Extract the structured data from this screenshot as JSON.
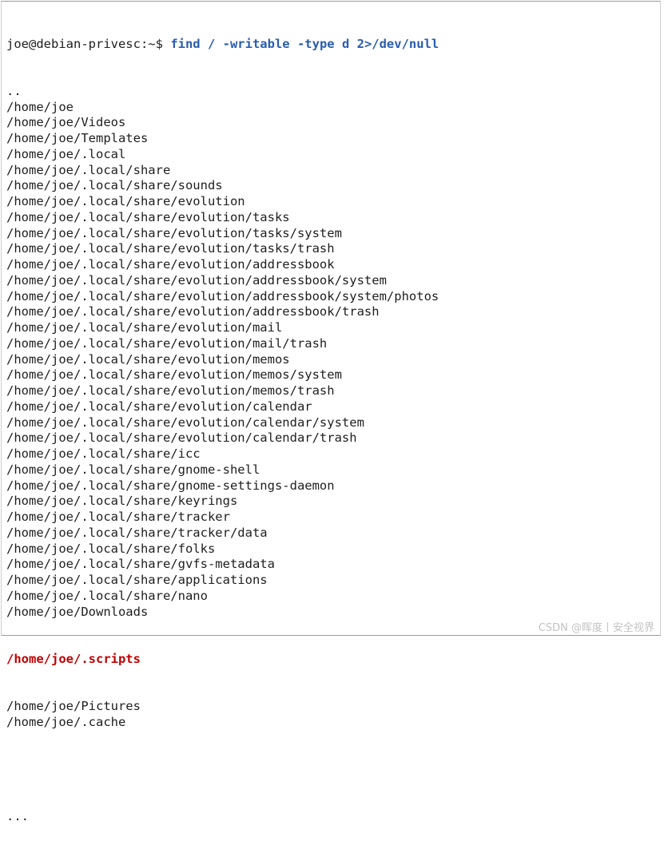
{
  "terminal": {
    "prompt": "joe@debian-privesc:~$ ",
    "command": "find / -writable -type d 2>/dev/null",
    "lines": [
      "..",
      "/home/joe",
      "/home/joe/Videos",
      "/home/joe/Templates",
      "/home/joe/.local",
      "/home/joe/.local/share",
      "/home/joe/.local/share/sounds",
      "/home/joe/.local/share/evolution",
      "/home/joe/.local/share/evolution/tasks",
      "/home/joe/.local/share/evolution/tasks/system",
      "/home/joe/.local/share/evolution/tasks/trash",
      "/home/joe/.local/share/evolution/addressbook",
      "/home/joe/.local/share/evolution/addressbook/system",
      "/home/joe/.local/share/evolution/addressbook/system/photos",
      "/home/joe/.local/share/evolution/addressbook/trash",
      "/home/joe/.local/share/evolution/mail",
      "/home/joe/.local/share/evolution/mail/trash",
      "/home/joe/.local/share/evolution/memos",
      "/home/joe/.local/share/evolution/memos/system",
      "/home/joe/.local/share/evolution/memos/trash",
      "/home/joe/.local/share/evolution/calendar",
      "/home/joe/.local/share/evolution/calendar/system",
      "/home/joe/.local/share/evolution/calendar/trash",
      "/home/joe/.local/share/icc",
      "/home/joe/.local/share/gnome-shell",
      "/home/joe/.local/share/gnome-settings-daemon",
      "/home/joe/.local/share/keyrings",
      "/home/joe/.local/share/tracker",
      "/home/joe/.local/share/tracker/data",
      "/home/joe/.local/share/folks",
      "/home/joe/.local/share/gvfs-metadata",
      "/home/joe/.local/share/applications",
      "/home/joe/.local/share/nano",
      "/home/joe/Downloads"
    ],
    "highlighted_line": "/home/joe/.scripts",
    "lines_after": [
      "/home/joe/Pictures",
      "/home/joe/.cache"
    ],
    "ellipsis": "..."
  },
  "watermark": "CSDN @晖度丨安全视界",
  "colors": {
    "command": "#2a5db0",
    "highlight": "#c00000",
    "text": "#1e1e1e"
  }
}
